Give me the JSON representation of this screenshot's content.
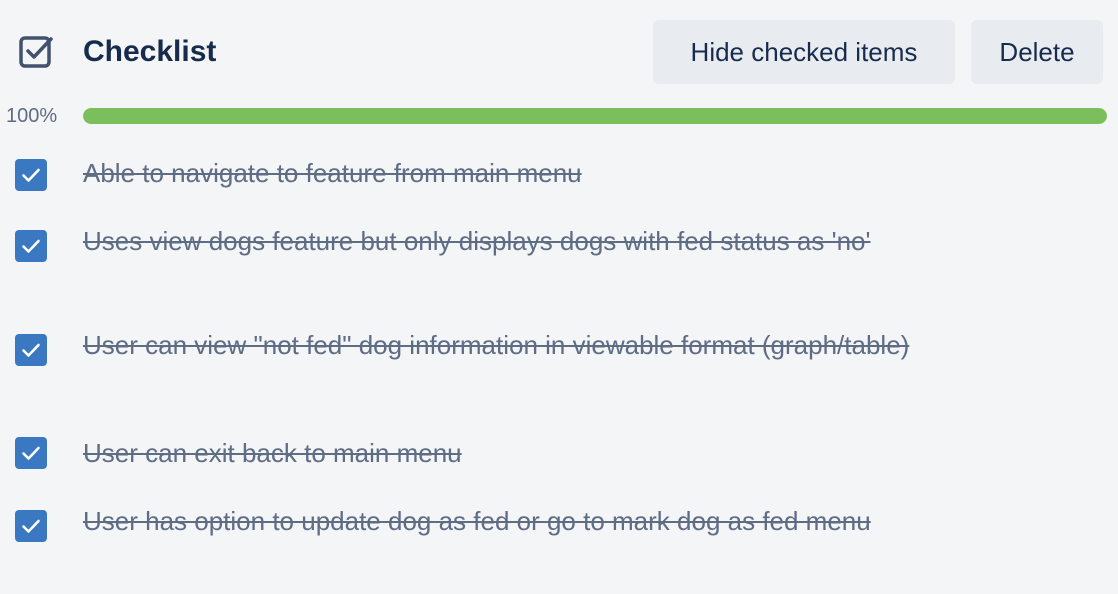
{
  "header": {
    "title": "Checklist",
    "hide_checked_label": "Hide checked items",
    "delete_label": "Delete",
    "icon": "checklist-icon"
  },
  "progress": {
    "label": "100%",
    "value": 1.0,
    "color": "#7bbf5c"
  },
  "items": [
    {
      "label": "Able to navigate to feature from main menu",
      "checked": true
    },
    {
      "label": "Uses view dogs feature but only displays dogs with fed status as 'no'",
      "checked": true
    },
    {
      "label": "User can view \"not fed\" dog information in viewable format (graph/table)",
      "checked": true
    },
    {
      "label": "User can exit back to main menu",
      "checked": true
    },
    {
      "label": "User has option to update dog as fed or go to mark dog as fed menu",
      "checked": true
    }
  ],
  "colors": {
    "accent": "#3a78c2",
    "text": "#172b4d",
    "muted": "#5e6c84",
    "button_bg": "#e8ebf0"
  }
}
